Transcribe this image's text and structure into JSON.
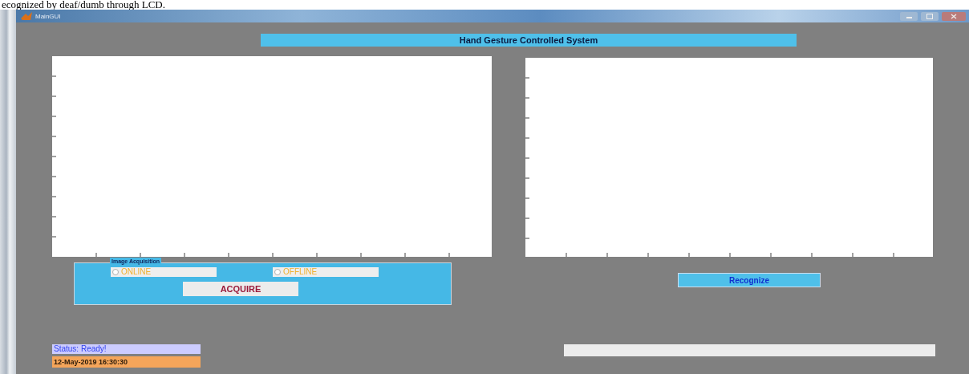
{
  "document_text": "ecognized by deaf/dumb through LCD.",
  "window": {
    "title": "MainGUI"
  },
  "banner": "Hand Gesture Controlled System",
  "acquisition_panel": {
    "title": "Image Acquisition",
    "options": [
      {
        "label": "ONLINE",
        "selected": false
      },
      {
        "label": "OFFLINE",
        "selected": false
      }
    ],
    "button": "ACQUIRE"
  },
  "recognize_button": "Recognize",
  "status": "Status: Ready!",
  "timestamp": "12-May-2019 16:30:30"
}
